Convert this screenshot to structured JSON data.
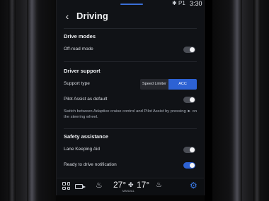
{
  "status": {
    "bluetooth": "✱",
    "signal": "P1",
    "time": "3:30"
  },
  "header": {
    "title": "Driving"
  },
  "sections": {
    "drive_modes": "Drive modes",
    "driver_support": "Driver support",
    "safety_assistance": "Safety assistance"
  },
  "settings": {
    "offroad": {
      "label": "Off-road mode",
      "state": "off"
    },
    "support_type": {
      "label": "Support type",
      "options": [
        "Speed Limiter",
        "ACC"
      ],
      "selected": "ACC"
    },
    "pilot_assist": {
      "label": "Pilot Assist as default",
      "state": "off",
      "description": "Switch between Adaptive cruise control and Pilot Assist by pressing ► on the steering wheel."
    },
    "lane_keeping": {
      "label": "Lane Keeping Aid",
      "state": "off"
    },
    "ready_to_drive": {
      "label": "Ready to drive notification",
      "state": "on"
    }
  },
  "climate": {
    "temp_left": "27°",
    "temp_right": "17°",
    "mode": "MANUAL"
  },
  "colors": {
    "accent": "#2d62d4",
    "background": "#101216"
  }
}
